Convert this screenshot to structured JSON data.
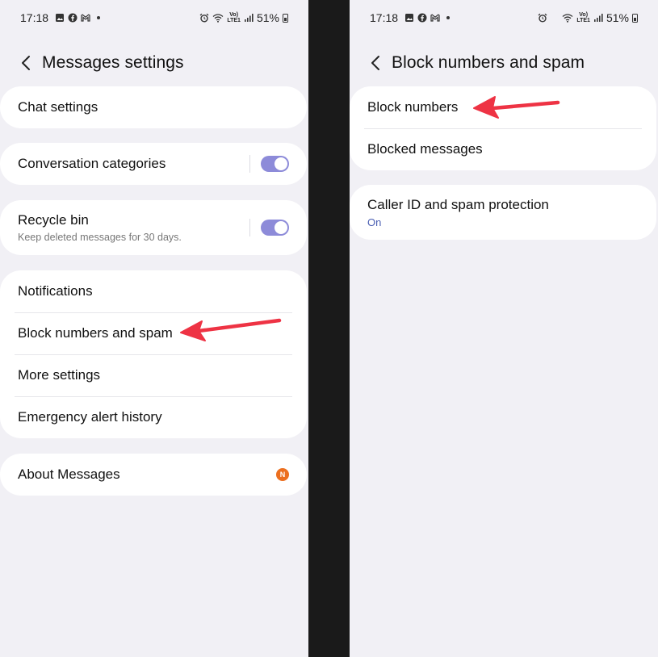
{
  "colors": {
    "background": "#f1f0f5",
    "card": "#ffffff",
    "toggle_on": "#8d8bd9",
    "badge": "#ec6f1f",
    "annotation_arrow": "#ee3344",
    "on_text": "#4b5fb3"
  },
  "status_bar": {
    "time": "17:18",
    "battery": "51%",
    "volte_top": "Vo)",
    "volte_bottom": "LTE1",
    "left_icons": [
      "gallery-icon",
      "facebook-icon",
      "gmail-icon"
    ],
    "right_icons_left_screen": [
      "alarm-icon",
      "wifi-icon",
      "signal-icon",
      "battery-icon"
    ],
    "right_icons_right_screen": [
      "alarm-icon",
      "wifi-icon",
      "signal-icon",
      "battery-icon"
    ]
  },
  "left_screen": {
    "title": "Messages settings",
    "chat_settings": "Chat settings",
    "conversation_categories": {
      "label": "Conversation categories",
      "enabled": true
    },
    "recycle_bin": {
      "label": "Recycle bin",
      "description": "Keep deleted messages for 30 days.",
      "enabled": true
    },
    "notifications": "Notifications",
    "block_numbers_and_spam": "Block numbers and spam",
    "more_settings": "More settings",
    "emergency_alert_history": "Emergency alert history",
    "about_messages": {
      "label": "About Messages",
      "badge": "N"
    }
  },
  "right_screen": {
    "title": "Block numbers and spam",
    "block_numbers": "Block numbers",
    "blocked_messages": "Blocked messages",
    "caller_id": {
      "label": "Caller ID and spam protection",
      "status": "On"
    }
  }
}
